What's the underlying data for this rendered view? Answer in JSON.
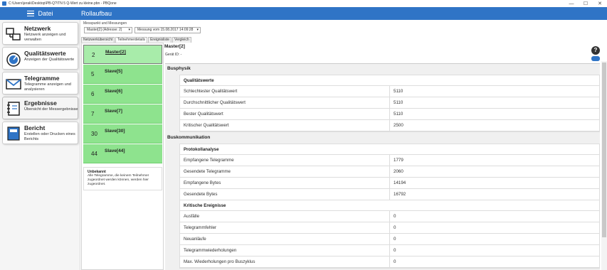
{
  "window": {
    "path": "C:\\Users\\jerak\\Desktop\\PB-Q?\\TN 5 Q-Wert zu kleine.pbn - PBQone",
    "minimize": "—",
    "maximize": "☐",
    "close": "✕"
  },
  "header": {
    "menu_label": "Datei",
    "page_title": "Rollaufbau"
  },
  "nav": [
    {
      "title": "Netzwerk",
      "subtitle": "Netzwerk anzeigen und verwalten"
    },
    {
      "title": "Qualitätswerte",
      "subtitle": "Anzeigen der Qualitätswerte"
    },
    {
      "title": "Telegramme",
      "subtitle": "Telegramme anzeigen und analysieren"
    },
    {
      "title": "Ergebnisse",
      "subtitle": "Übersicht der Messergebnisse"
    },
    {
      "title": "Bericht",
      "subtitle": "Erstellen oder Drucken eines Berichts"
    }
  ],
  "controls": {
    "label": "Messpunkt und Messungen",
    "measure_point": "Master[2] (Adresse: 2)",
    "measurement": "Messung vom 15.08.2017 14:09:28"
  },
  "tabs": [
    "Netzwerkübersicht",
    "Teilnehmerdetails",
    "Ereignisliste",
    "Vergleich"
  ],
  "devices": [
    {
      "num": "2",
      "name": "Master[2]"
    },
    {
      "num": "5",
      "name": "Slave[5]"
    },
    {
      "num": "6",
      "name": "Slave[6]"
    },
    {
      "num": "7",
      "name": "Slave[7]"
    },
    {
      "num": "30",
      "name": "Slave[30]"
    },
    {
      "num": "44",
      "name": "Slave[44]"
    }
  ],
  "unknown": {
    "title": "Unbekannt",
    "text": "Alle Telegramme, die keinem Teilnehmer zugeordnet werden können, werden hier zugeordnet."
  },
  "details": {
    "title": "Master[2]",
    "device_id": "Gerät ID: -",
    "help": "?",
    "sections": {
      "busphysik": "Busphysik",
      "quality_title": "Qualitätswerte",
      "quality_rows": [
        {
          "k": "Schlechtester Qualitätswert",
          "v": "5110"
        },
        {
          "k": "Durchschnittlicher Qualitätswert",
          "v": "5110"
        },
        {
          "k": "Bester Qualitätswert",
          "v": "5110"
        },
        {
          "k": "Kritischer Qualitätswert",
          "v": "2500"
        }
      ],
      "buskomm": "Buskommunikation",
      "proto_title": "Protokollanalyse",
      "proto_rows": [
        {
          "k": "Empfangene Telegramme",
          "v": "1779"
        },
        {
          "k": "Gesendete Telegramme",
          "v": "2060"
        },
        {
          "k": "Empfangene Bytes",
          "v": "14194"
        },
        {
          "k": "Gesendete Bytes",
          "v": "16792"
        }
      ],
      "crit_title": "Kritische Ereignisse",
      "crit_rows": [
        {
          "k": "Ausfälle",
          "v": "0"
        },
        {
          "k": "Telegrammfehler",
          "v": "0"
        },
        {
          "k": "Neuanläufe",
          "v": "0"
        },
        {
          "k": "Telegrammwiederholungen",
          "v": "0"
        },
        {
          "k": "Max. Wiederholungen pro Buszyklus",
          "v": "0"
        }
      ]
    }
  },
  "colors": {
    "accent": "#2f74c6",
    "device_green": "#8ee38e"
  }
}
